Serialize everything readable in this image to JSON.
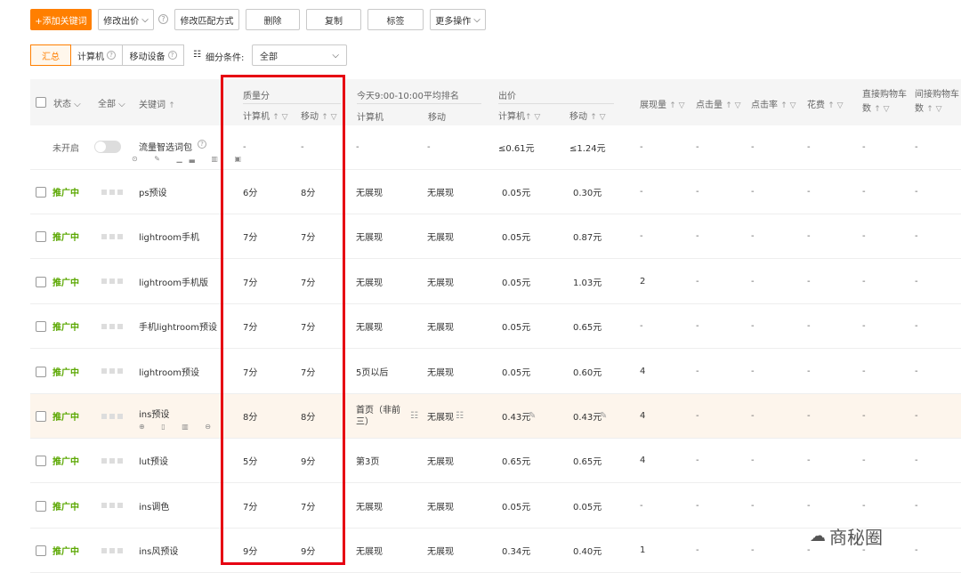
{
  "toolbar": {
    "add_keyword": "+添加关键词",
    "modify_bid": "修改出价",
    "modify_match": "修改匹配方式",
    "delete": "删除",
    "copy": "复制",
    "tag": "标签",
    "more_ops": "更多操作"
  },
  "filters": {
    "summary": "汇总",
    "computer": "计算机",
    "mobile": "移动设备",
    "condition_label": "细分条件:",
    "condition_value": "全部"
  },
  "headers": {
    "status": "状态",
    "all": "全部",
    "keyword": "关键词",
    "quality": "质量分",
    "q_pc": "计算机",
    "q_mobile": "移动",
    "rank": "今天9:00-10:00平均排名",
    "r_pc": "计算机",
    "r_mobile": "移动",
    "bid": "出价",
    "b_pc": "计算机",
    "b_mobile": "移动",
    "impressions": "展现量",
    "clicks": "点击量",
    "ctr": "点击率",
    "cost": "花费",
    "direct_cart_1": "直接购物车",
    "direct_cart_2": "数",
    "indirect_cart_1": "间接购物车",
    "indirect_cart_2": "数"
  },
  "pkg_row": {
    "status": "未开启",
    "name": "流量智选词包",
    "q_pc": "-",
    "q_mobile": "-",
    "r_pc": "-",
    "r_mobile": "-",
    "b_pc": "≤0.61元",
    "b_mobile": "≤1.24元",
    "dash": "-"
  },
  "rows": [
    {
      "status": "推广中",
      "keyword": "ps预设",
      "q_pc": "6分",
      "q_mobile": "8分",
      "r_pc": "无展现",
      "r_mobile": "无展现",
      "b_pc": "0.05元",
      "b_mobile": "0.30元",
      "impressions": "-"
    },
    {
      "status": "推广中",
      "keyword": "lightroom手机",
      "q_pc": "7分",
      "q_mobile": "7分",
      "r_pc": "无展现",
      "r_mobile": "无展现",
      "b_pc": "0.05元",
      "b_mobile": "0.87元",
      "impressions": "-"
    },
    {
      "status": "推广中",
      "keyword": "lightroom手机版",
      "q_pc": "7分",
      "q_mobile": "7分",
      "r_pc": "无展现",
      "r_mobile": "无展现",
      "b_pc": "0.05元",
      "b_mobile": "1.03元",
      "impressions": "2"
    },
    {
      "status": "推广中",
      "keyword": "手机lightroom预设",
      "q_pc": "7分",
      "q_mobile": "7分",
      "r_pc": "无展现",
      "r_mobile": "无展现",
      "b_pc": "0.05元",
      "b_mobile": "0.65元",
      "impressions": "-"
    },
    {
      "status": "推广中",
      "keyword": "lightroom预设",
      "q_pc": "7分",
      "q_mobile": "7分",
      "r_pc": "5页以后",
      "r_mobile": "无展现",
      "b_pc": "0.05元",
      "b_mobile": "0.60元",
      "impressions": "4"
    },
    {
      "status": "推广中",
      "keyword": "ins预设",
      "q_pc": "8分",
      "q_mobile": "8分",
      "r_pc": "首页（非前三）",
      "r_mobile": "无展现",
      "b_pc": "0.43元",
      "b_mobile": "0.43元",
      "impressions": "4"
    },
    {
      "status": "推广中",
      "keyword": "lut预设",
      "q_pc": "5分",
      "q_mobile": "9分",
      "r_pc": "第3页",
      "r_mobile": "无展现",
      "b_pc": "0.65元",
      "b_mobile": "0.65元",
      "impressions": "4"
    },
    {
      "status": "推广中",
      "keyword": "ins调色",
      "q_pc": "7分",
      "q_mobile": "7分",
      "r_pc": "无展现",
      "r_mobile": "无展现",
      "b_pc": "0.05元",
      "b_mobile": "0.05元",
      "impressions": "-"
    },
    {
      "status": "推广中",
      "keyword": "ins风预设",
      "q_pc": "9分",
      "q_mobile": "9分",
      "r_pc": "无展现",
      "r_mobile": "无展现",
      "b_pc": "0.34元",
      "b_mobile": "0.40元",
      "impressions": "1"
    }
  ],
  "dash": "-",
  "watermark": "商秘圈",
  "colors": {
    "accent": "#ff7f00",
    "status_green": "#5aa700",
    "highlight_box": "#e60012"
  }
}
